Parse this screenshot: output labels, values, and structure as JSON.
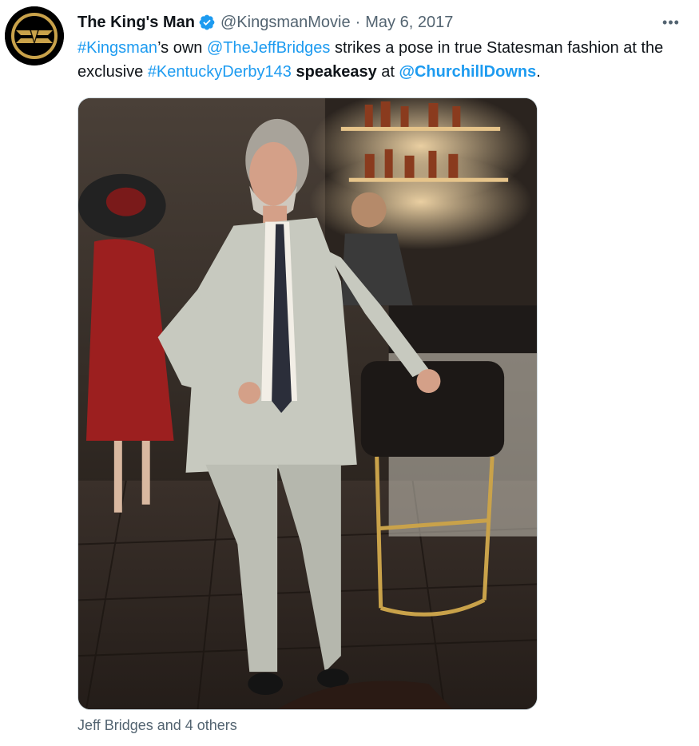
{
  "author": {
    "display_name": "The King's Man",
    "handle": "@KingsmanMovie",
    "separator": "·",
    "date": "May 6, 2017",
    "avatar_icon": "kingsman-logo-icon",
    "verified_icon": "verified-badge-icon"
  },
  "more_label": "•••",
  "text": {
    "hashtag1": "#Kingsman",
    "t1": "’s own ",
    "mention1": "@TheJeffBridges",
    "t2": " strikes a pose in true Statesman fashion at the exclusive ",
    "hashtag2": "#KentuckyDerby143",
    "t3": " ",
    "bold": "speakeasy",
    "t4": " at ",
    "mention2": "@ChurchillDowns",
    "t5": "."
  },
  "media": {
    "icon": "photo-bar-scene"
  },
  "tagged_people": "Jeff Bridges and 4 others",
  "colors": {
    "link": "#1d9bf0",
    "secondary_text": "#536471",
    "primary_text": "#0f1419",
    "border": "#cfd9de"
  }
}
